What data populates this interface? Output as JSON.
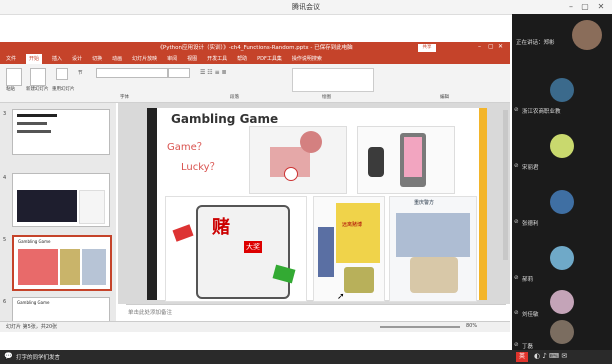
{
  "meeting": {
    "title": "腾讯会议"
  },
  "ppt": {
    "title": "《Python应用设计（实训）》-ch4_Functions-Random.pptx - 已保存到此电脑",
    "share_button": "共享",
    "menus": [
      "文件",
      "开始",
      "插入",
      "设计",
      "切换",
      "动画",
      "幻灯片放映",
      "审阅",
      "视图",
      "开发工具",
      "帮助",
      "PDF工具集",
      "操作说明搜索"
    ],
    "active_menu": "开始",
    "ribbon_labels": [
      "粘贴",
      "新建幻灯片",
      "重用幻灯片",
      "节",
      "字体",
      "段落",
      "绘图",
      "编辑"
    ],
    "thumb_numbers": [
      "3",
      "4",
      "5",
      "6"
    ],
    "thumb5_title": "Gambling Game",
    "thumb6_title": "Gambling Game",
    "notes_placeholder": "单击此处添加备注",
    "status_left": "幻灯片 第5张，共20张",
    "status_right": "80%",
    "zoom": "80%"
  },
  "slide": {
    "title": "Gambling Game",
    "question1": "Game？",
    "question2": "Lucky？",
    "cartoon_text_bet": "赌",
    "cartoon_text_prize": "大奖",
    "cartoon_text_keep_away": "远离赌博",
    "cartoon_text_police": "重庆警方"
  },
  "participants": [
    {
      "name": "正在讲话：郑彬",
      "color": "#8a6d5a",
      "is_header": true
    },
    {
      "name": "浙江农商职业教",
      "color": "#3b6a8c"
    },
    {
      "name": "宋丽君",
      "color": "#c9d96e"
    },
    {
      "name": "张德利",
      "color": "#3f6fa3"
    },
    {
      "name": "郝莉",
      "color": "#6fa9c8"
    },
    {
      "name": "刘佳敏",
      "color": "#c4a4b8"
    },
    {
      "name": "丁磊",
      "color": "#7b6d60"
    }
  ],
  "taskbar": {
    "input_method": "英",
    "chat_label": "打字的同学们发言"
  }
}
